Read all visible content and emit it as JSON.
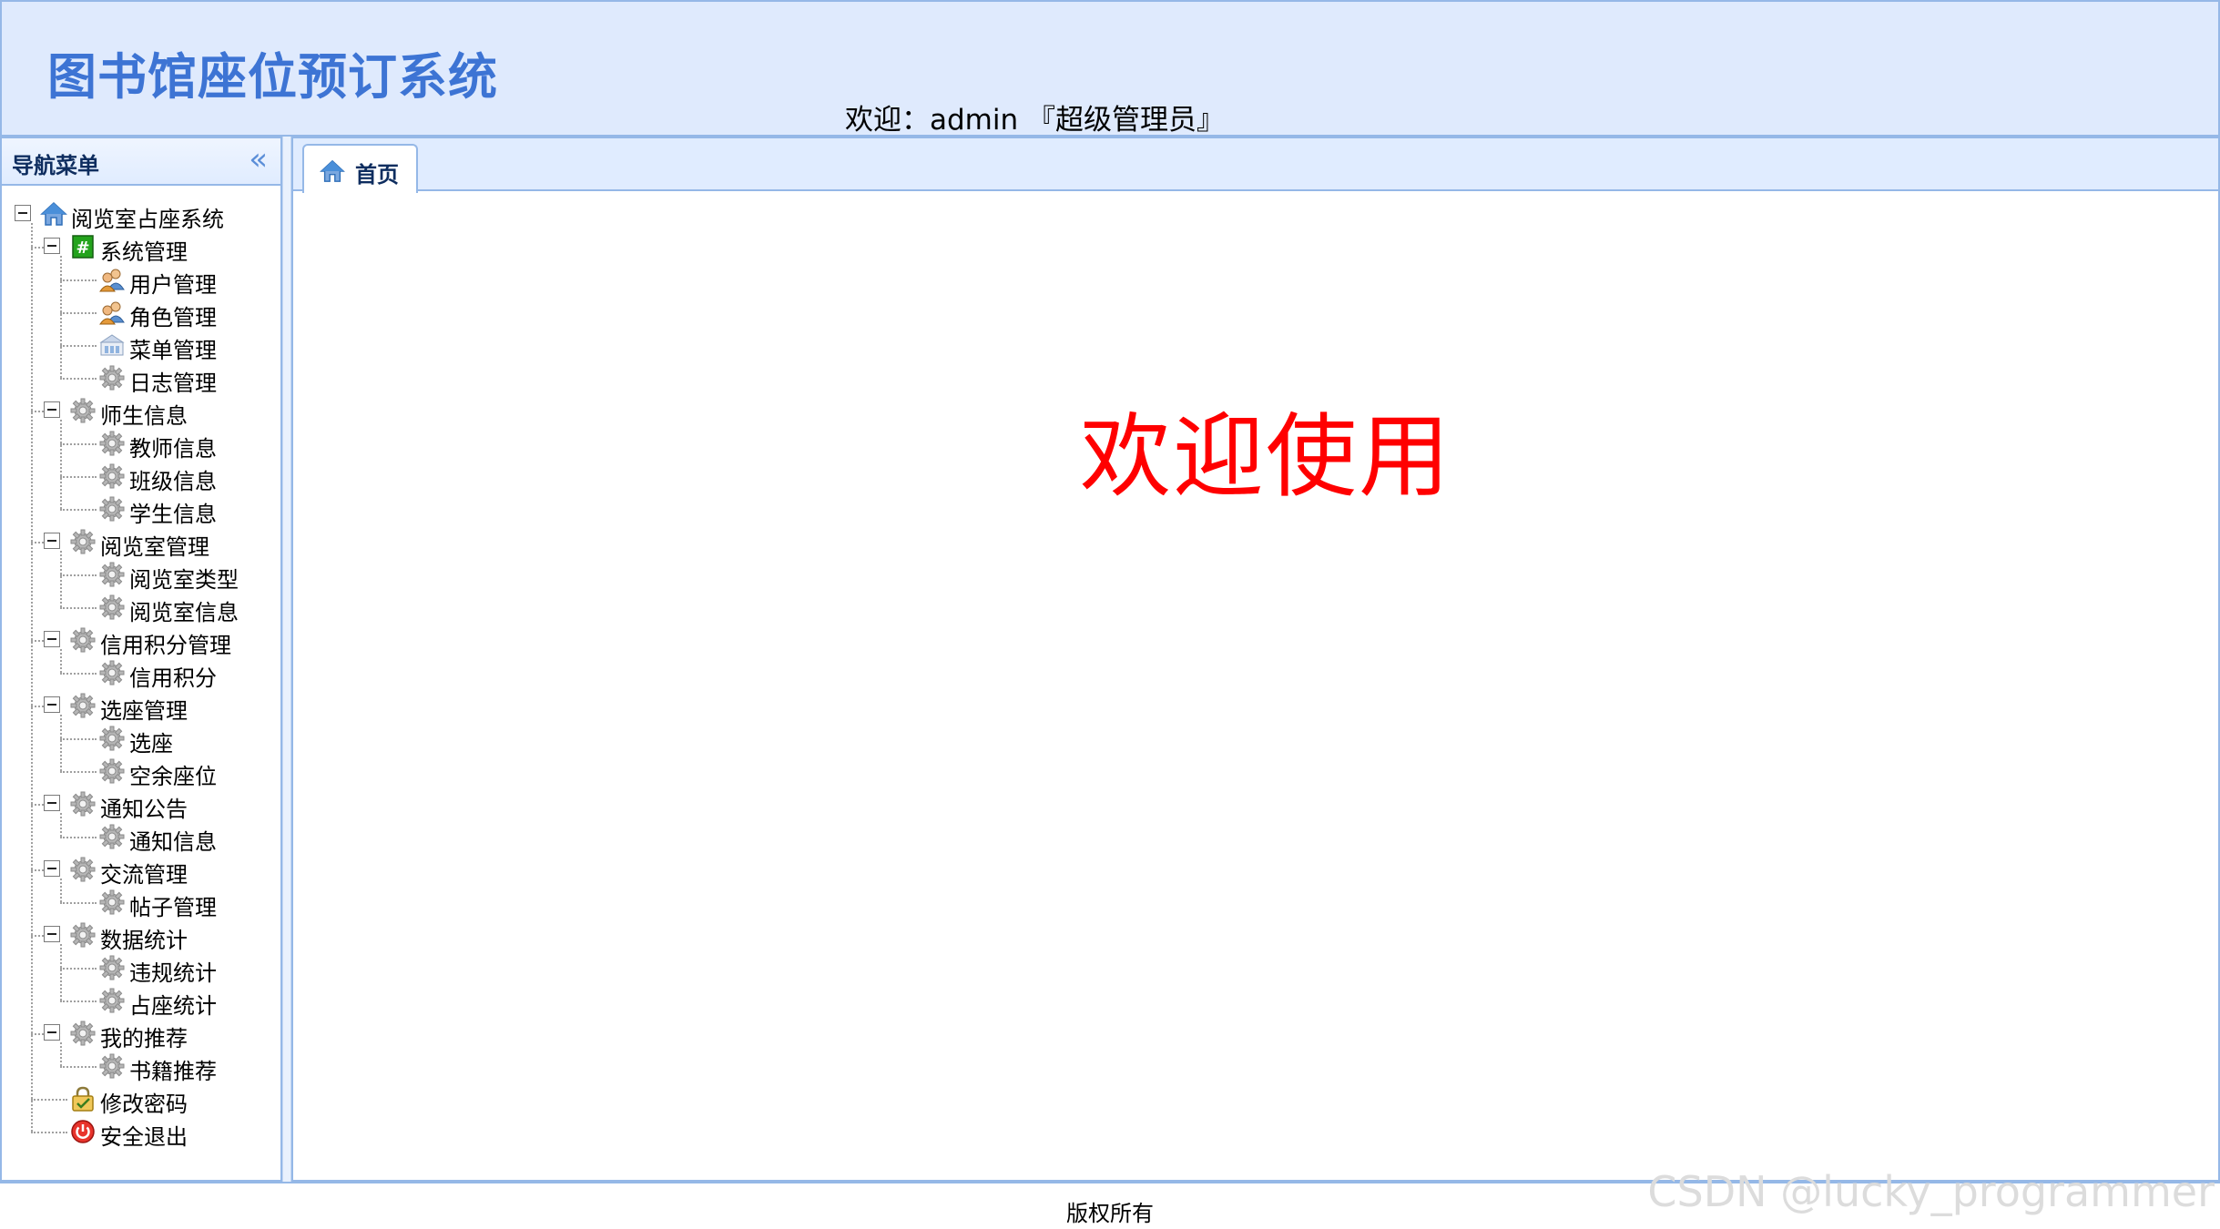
{
  "header": {
    "app_title": "图书馆座位预订系统",
    "welcome": "欢迎：admin 『超级管理员』"
  },
  "sidebar": {
    "title": "导航菜单",
    "collapse_icon": "double-chevron-left-icon",
    "tree": {
      "root": {
        "label": "阅览室占座系统",
        "icon": "home-icon"
      },
      "groups": [
        {
          "label": "系统管理",
          "icon": "hash-icon",
          "children": [
            {
              "label": "用户管理",
              "icon": "users-icon"
            },
            {
              "label": "角色管理",
              "icon": "users-icon"
            },
            {
              "label": "菜单管理",
              "icon": "menu-icon"
            },
            {
              "label": "日志管理",
              "icon": "gear-icon"
            }
          ]
        },
        {
          "label": "师生信息",
          "icon": "gear-icon",
          "children": [
            {
              "label": "教师信息",
              "icon": "gear-icon"
            },
            {
              "label": "班级信息",
              "icon": "gear-icon"
            },
            {
              "label": "学生信息",
              "icon": "gear-icon"
            }
          ]
        },
        {
          "label": "阅览室管理",
          "icon": "gear-icon",
          "children": [
            {
              "label": "阅览室类型",
              "icon": "gear-icon"
            },
            {
              "label": "阅览室信息",
              "icon": "gear-icon"
            }
          ]
        },
        {
          "label": "信用积分管理",
          "icon": "gear-icon",
          "children": [
            {
              "label": "信用积分",
              "icon": "gear-icon"
            }
          ]
        },
        {
          "label": "选座管理",
          "icon": "gear-icon",
          "children": [
            {
              "label": "选座",
              "icon": "gear-icon"
            },
            {
              "label": "空余座位",
              "icon": "gear-icon"
            }
          ]
        },
        {
          "label": "通知公告",
          "icon": "gear-icon",
          "children": [
            {
              "label": "通知信息",
              "icon": "gear-icon"
            }
          ]
        },
        {
          "label": "交流管理",
          "icon": "gear-icon",
          "children": [
            {
              "label": "帖子管理",
              "icon": "gear-icon"
            }
          ]
        },
        {
          "label": "数据统计",
          "icon": "gear-icon",
          "children": [
            {
              "label": "违规统计",
              "icon": "gear-icon"
            },
            {
              "label": "占座统计",
              "icon": "gear-icon"
            }
          ]
        },
        {
          "label": "我的推荐",
          "icon": "gear-icon",
          "children": [
            {
              "label": "书籍推荐",
              "icon": "gear-icon"
            }
          ]
        }
      ],
      "leaves": [
        {
          "label": "修改密码",
          "icon": "lock-icon"
        },
        {
          "label": "安全退出",
          "icon": "power-icon"
        }
      ]
    }
  },
  "tabs": [
    {
      "label": "首页",
      "icon": "home-icon"
    }
  ],
  "main": {
    "welcome_text": "欢迎使用"
  },
  "footer": {
    "copyright": "版权所有"
  },
  "watermark": "CSDN @lucky_programmer",
  "colors": {
    "border": "#95b8e7",
    "header_bg": "#dfeafd",
    "title_blue": "#3d74d4",
    "welcome_red": "#ff0000"
  }
}
